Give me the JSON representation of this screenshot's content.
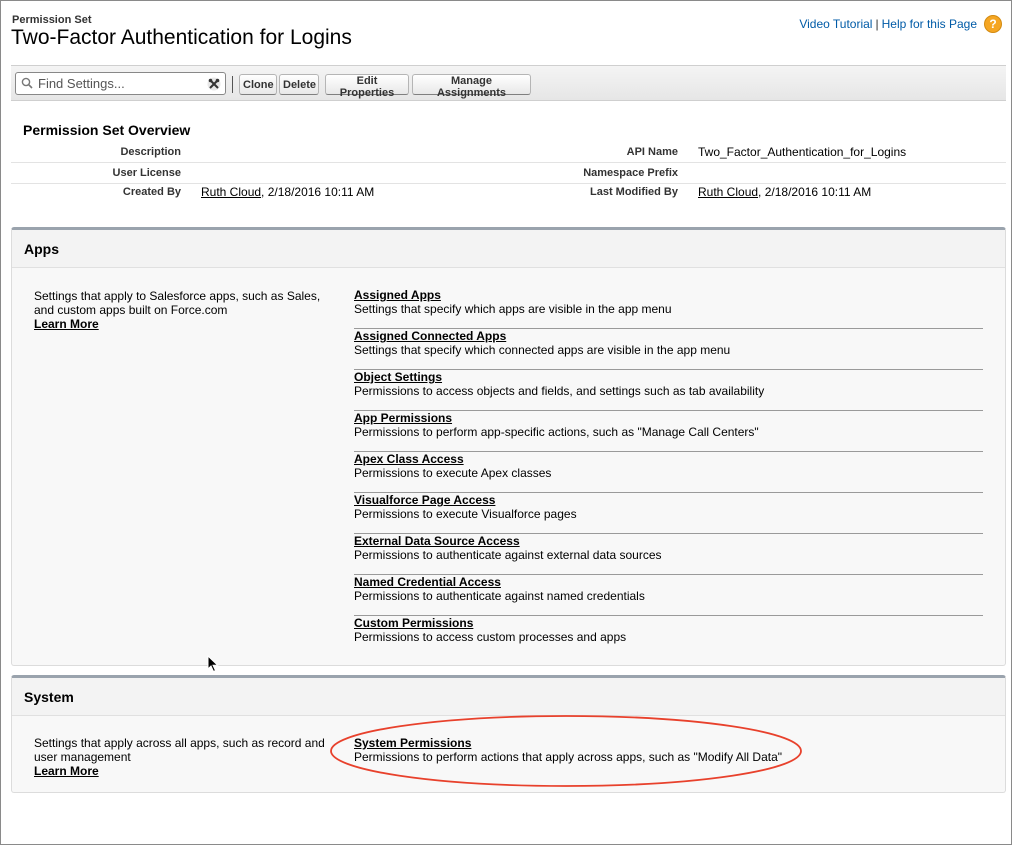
{
  "header": {
    "eyebrow": "Permission Set",
    "title": "Two-Factor Authentication for Logins",
    "video_tutorial": "Video Tutorial",
    "separator": "|",
    "help_link": "Help for this Page",
    "help_icon_glyph": "?"
  },
  "toolbar": {
    "search_placeholder": "Find Settings...",
    "clone_label": "Clone",
    "delete_label": "Delete",
    "edit_label": "Edit Properties",
    "manage_label": "Manage Assignments"
  },
  "overview": {
    "title": "Permission Set Overview",
    "rows": [
      {
        "left_label": "Description",
        "left_value": "",
        "right_label": "API Name",
        "right_value": "Two_Factor_Authentication_for_Logins"
      },
      {
        "left_label": "User License",
        "left_value": "",
        "right_label": "Namespace Prefix",
        "right_value": ""
      },
      {
        "left_label": "Created By",
        "left_link": "Ruth Cloud",
        "left_value": ", 2/18/2016 10:11 AM",
        "right_label": "Last Modified By",
        "right_link": "Ruth Cloud",
        "right_value": ", 2/18/2016 10:11 AM"
      }
    ]
  },
  "apps": {
    "title": "Apps",
    "desc": "Settings that apply to Salesforce apps, such as Sales, and custom apps built on Force.com",
    "learn_more": "Learn More",
    "items": [
      {
        "title": "Assigned Apps",
        "desc": "Settings that specify which apps are visible in the app menu"
      },
      {
        "title": "Assigned Connected Apps",
        "desc": "Settings that specify which connected apps are visible in the app menu"
      },
      {
        "title": "Object Settings",
        "desc": "Permissions to access objects and fields, and settings such as tab availability"
      },
      {
        "title": "App Permissions",
        "desc": "Permissions to perform app-specific actions, such as \"Manage Call Centers\""
      },
      {
        "title": "Apex Class Access",
        "desc": "Permissions to execute Apex classes"
      },
      {
        "title": "Visualforce Page Access",
        "desc": "Permissions to execute Visualforce pages"
      },
      {
        "title": "External Data Source Access",
        "desc": "Permissions to authenticate against external data sources"
      },
      {
        "title": "Named Credential Access",
        "desc": "Permissions to authenticate against named credentials"
      },
      {
        "title": "Custom Permissions",
        "desc": "Permissions to access custom processes and apps"
      }
    ]
  },
  "system": {
    "title": "System",
    "desc": "Settings that apply across all apps, such as record and user management",
    "learn_more": "Learn More",
    "items": [
      {
        "title": "System Permissions",
        "desc": "Permissions to perform actions that apply across apps, such as \"Modify All Data\""
      }
    ]
  },
  "colors": {
    "link_blue": "#015ba7",
    "help_orange": "#f5a623",
    "highlight_red": "#e8412c",
    "section_border": "#9aa3ad"
  },
  "icons": {
    "search": "search-icon",
    "tools": "tools-icon",
    "help": "help-icon",
    "cursor": "cursor-icon"
  }
}
